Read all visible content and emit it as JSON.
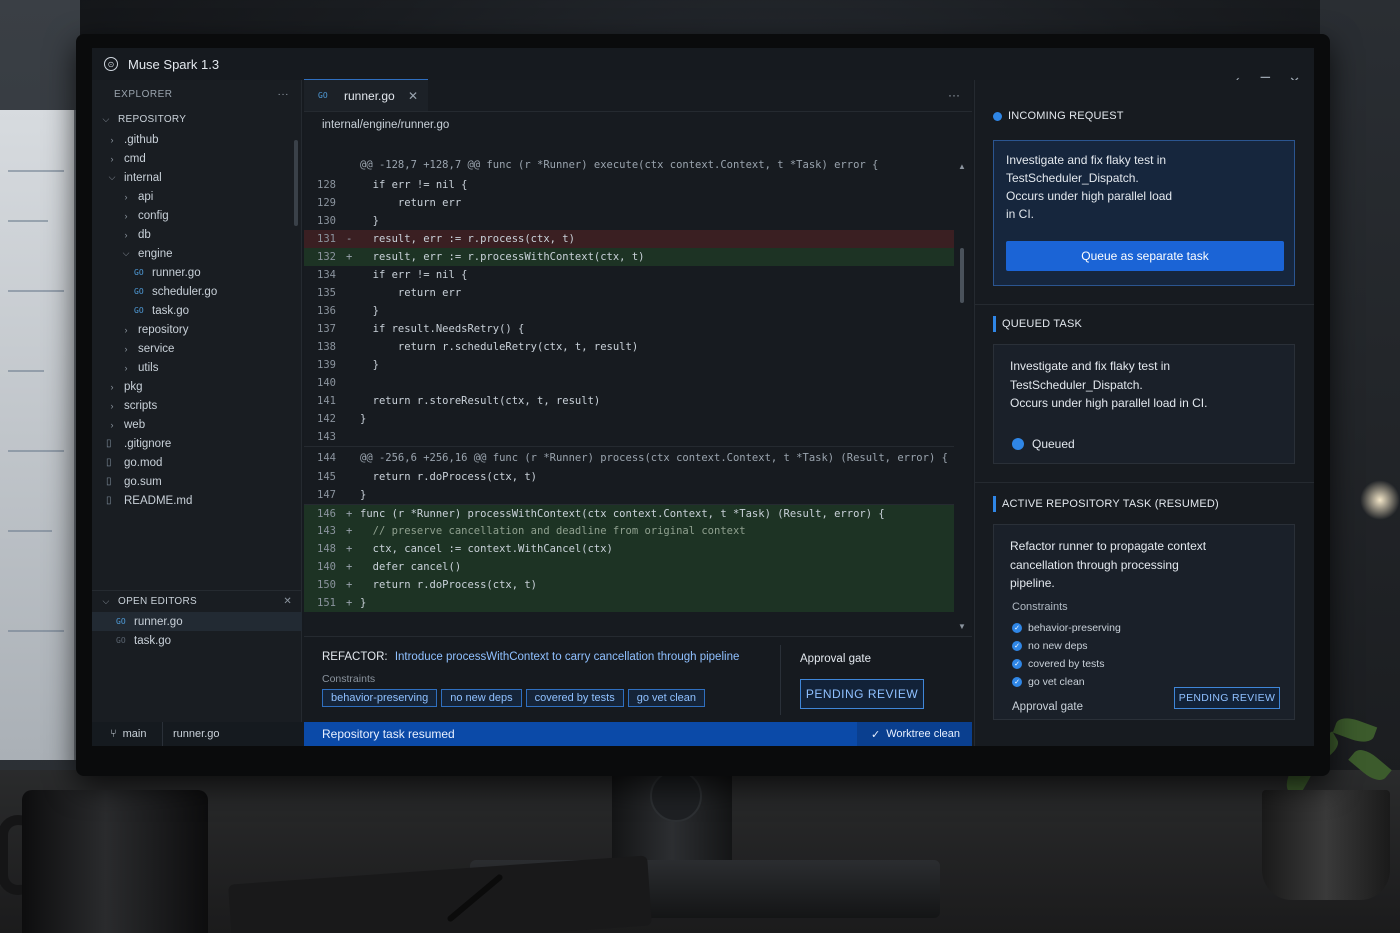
{
  "app": {
    "title": "Muse Spark 1.3",
    "logo": "⊙"
  },
  "sidebar": {
    "header": "EXPLORER",
    "more": "···",
    "section": "REPOSITORY",
    "tree": [
      {
        "label": ".github",
        "type": "folder",
        "depth": 0,
        "open": false
      },
      {
        "label": "cmd",
        "type": "folder",
        "depth": 0,
        "open": false
      },
      {
        "label": "internal",
        "type": "folder",
        "depth": 0,
        "open": true
      },
      {
        "label": "api",
        "type": "folder",
        "depth": 1,
        "open": false
      },
      {
        "label": "config",
        "type": "folder",
        "depth": 1,
        "open": false
      },
      {
        "label": "db",
        "type": "folder",
        "depth": 1,
        "open": false
      },
      {
        "label": "engine",
        "type": "folder",
        "depth": 1,
        "open": true
      },
      {
        "label": "runner.go",
        "type": "go",
        "depth": 2
      },
      {
        "label": "scheduler.go",
        "type": "go",
        "depth": 2
      },
      {
        "label": "task.go",
        "type": "go",
        "depth": 2
      },
      {
        "label": "repository",
        "type": "folder",
        "depth": 1,
        "open": false
      },
      {
        "label": "service",
        "type": "folder",
        "depth": 1,
        "open": false
      },
      {
        "label": "utils",
        "type": "folder",
        "depth": 1,
        "open": false
      },
      {
        "label": "pkg",
        "type": "folder",
        "depth": 0,
        "open": false
      },
      {
        "label": "scripts",
        "type": "folder",
        "depth": 0,
        "open": false
      },
      {
        "label": "web",
        "type": "folder",
        "depth": 0,
        "open": false
      },
      {
        "label": ".gitignore",
        "type": "file",
        "depth": 0
      },
      {
        "label": "go.mod",
        "type": "file",
        "depth": 0
      },
      {
        "label": "go.sum",
        "type": "file",
        "depth": 0
      },
      {
        "label": "README.md",
        "type": "file",
        "depth": 0
      }
    ],
    "open_editors": {
      "label": "OPEN EDITORS",
      "items": [
        {
          "label": "runner.go",
          "active": true
        },
        {
          "label": "task.go",
          "active": false
        }
      ]
    },
    "footer": {
      "branch": "main",
      "file": "runner.go"
    }
  },
  "editor": {
    "tab": "runner.go",
    "breadcrumb": "internal/engine/runner.go",
    "lines": [
      {
        "kind": "hunk",
        "ln": "",
        "text": "@@ -128,7 +128,7 @@ func (r *Runner) execute(ctx context.Context, t *Task) error {"
      },
      {
        "kind": "ctx",
        "ln": "128",
        "text": "  if err != nil {"
      },
      {
        "kind": "ctx",
        "ln": "129",
        "text": "      return err"
      },
      {
        "kind": "ctx",
        "ln": "130",
        "text": "  }"
      },
      {
        "kind": "del",
        "ln": "131",
        "mark": "-",
        "text": "  result, err := r.process(ctx, t)"
      },
      {
        "kind": "add",
        "ln": "132",
        "mark": "+",
        "text": "  result, err := r.processWithContext(ctx, t)"
      },
      {
        "kind": "ctx",
        "ln": "134",
        "text": "  if err != nil {"
      },
      {
        "kind": "ctx",
        "ln": "135",
        "text": "      return err"
      },
      {
        "kind": "ctx",
        "ln": "136",
        "text": "  }"
      },
      {
        "kind": "ctx",
        "ln": "137",
        "text": "  if result.NeedsRetry() {"
      },
      {
        "kind": "ctx",
        "ln": "138",
        "text": "      return r.scheduleRetry(ctx, t, result)"
      },
      {
        "kind": "ctx",
        "ln": "139",
        "text": "  }"
      },
      {
        "kind": "ctx",
        "ln": "140",
        "text": ""
      },
      {
        "kind": "ctx",
        "ln": "141",
        "text": "  return r.storeResult(ctx, t, result)"
      },
      {
        "kind": "ctx",
        "ln": "142",
        "text": "}"
      },
      {
        "kind": "ctx",
        "ln": "143",
        "text": ""
      },
      {
        "kind": "hunk",
        "ln": "144",
        "text": "@@ -256,6 +256,16 @@ func (r *Runner) process(ctx context.Context, t *Task) (Result, error) {"
      },
      {
        "kind": "ctx",
        "ln": "145",
        "text": "  return r.doProcess(ctx, t)"
      },
      {
        "kind": "ctx",
        "ln": "147",
        "text": "}"
      },
      {
        "kind": "add",
        "ln": "146",
        "mark": "+",
        "text": "func (r *Runner) processWithContext(ctx context.Context, t *Task) (Result, error) {"
      },
      {
        "kind": "add",
        "ln": "143",
        "mark": "+",
        "text": "  // preserve cancellation and deadline from original context"
      },
      {
        "kind": "add",
        "ln": "148",
        "mark": "+",
        "text": "  ctx, cancel := context.WithCancel(ctx)"
      },
      {
        "kind": "add",
        "ln": "140",
        "mark": "+",
        "text": "  defer cancel()"
      },
      {
        "kind": "add",
        "ln": "150",
        "mark": "+",
        "text": "  return r.doProcess(ctx, t)"
      },
      {
        "kind": "add",
        "ln": "151",
        "mark": "+",
        "text": "}"
      }
    ],
    "refactor": {
      "label": "REFACTOR:",
      "description": "Introduce processWithContext to carry cancellation through pipeline",
      "constraints_label": "Constraints",
      "constraints": [
        "behavior-preserving",
        "no new deps",
        "covered by tests",
        "go vet clean"
      ],
      "approval_label": "Approval gate",
      "approval_status": "PENDING REVIEW"
    },
    "status": {
      "left": "Repository task resumed",
      "right": "Worktree clean"
    }
  },
  "panel": {
    "incoming": {
      "heading": "INCOMING REQUEST",
      "text_lines": [
        "Investigate and fix flaky test in",
        "TestScheduler_Dispatch.",
        "Occurs under high parallel load",
        "in CI."
      ],
      "button": "Queue as separate task"
    },
    "queued": {
      "heading": "QUEUED TASK",
      "text_lines": [
        "Investigate and fix flaky test in",
        "TestScheduler_Dispatch.",
        "Occurs under high parallel load in CI."
      ],
      "status": "Queued"
    },
    "active": {
      "heading": "ACTIVE REPOSITORY TASK (RESUMED)",
      "text_lines": [
        "Refactor runner to propagate context",
        "cancellation through processing",
        "pipeline."
      ],
      "constraints_label": "Constraints",
      "constraints": [
        "behavior-preserving",
        "no new deps",
        "covered by tests",
        "go vet clean"
      ],
      "approval_label": "Approval gate",
      "approval_status": "PENDING REVIEW"
    }
  },
  "window_controls": [
    "✓",
    "☰",
    "✕"
  ],
  "colors": {
    "accent": "#2f86e6",
    "status_bar": "#0b4aa8",
    "add_bg": "#1d3324",
    "del_bg": "#3a1f22"
  }
}
